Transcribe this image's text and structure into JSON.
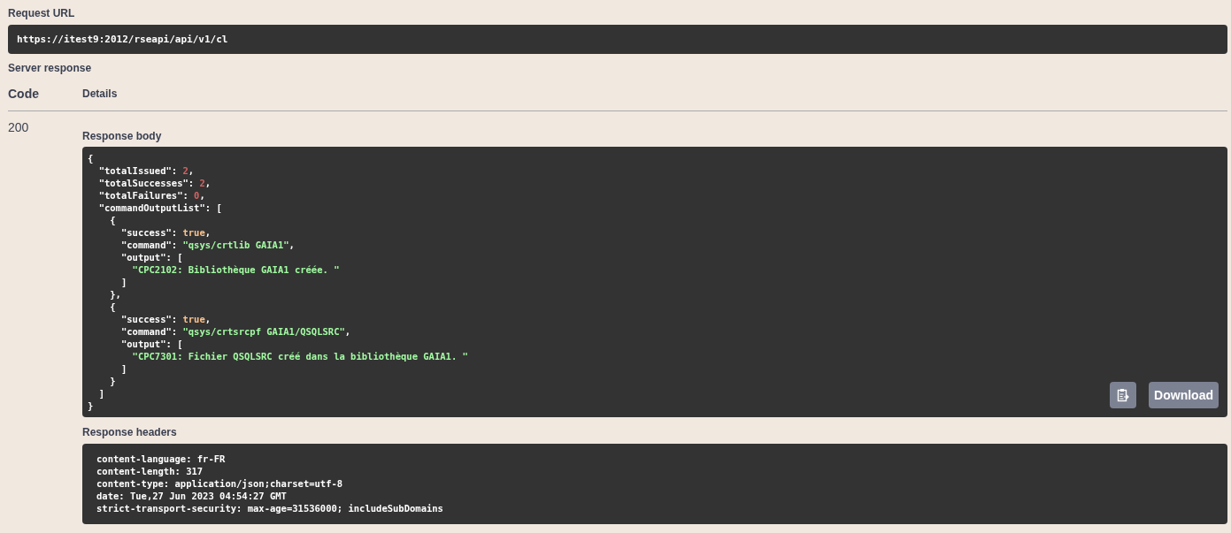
{
  "request_url": {
    "label": "Request URL",
    "value": "https://itest9:2012/rseapi/api/v1/cl"
  },
  "server_response": {
    "label": "Server response",
    "columns": [
      "Code",
      "Details"
    ],
    "code": "200",
    "body": {
      "label": "Response body",
      "lines": [
        [
          {
            "kind": "punct",
            "text": "{"
          }
        ],
        [
          {
            "kind": "punct",
            "text": "  \"totalIssued\": "
          },
          {
            "kind": "number",
            "text": "2"
          },
          {
            "kind": "punct",
            "text": ","
          }
        ],
        [
          {
            "kind": "punct",
            "text": "  \"totalSuccesses\": "
          },
          {
            "kind": "number",
            "text": "2"
          },
          {
            "kind": "punct",
            "text": ","
          }
        ],
        [
          {
            "kind": "punct",
            "text": "  \"totalFailures\": "
          },
          {
            "kind": "number",
            "text": "0"
          },
          {
            "kind": "punct",
            "text": ","
          }
        ],
        [
          {
            "kind": "punct",
            "text": "  \"commandOutputList\": ["
          }
        ],
        [
          {
            "kind": "punct",
            "text": "    {"
          }
        ],
        [
          {
            "kind": "punct",
            "text": "      \"success\": "
          },
          {
            "kind": "boolean",
            "text": "true"
          },
          {
            "kind": "punct",
            "text": ","
          }
        ],
        [
          {
            "kind": "punct",
            "text": "      \"command\": "
          },
          {
            "kind": "string",
            "text": "\"qsys/crtlib GAIA1\""
          },
          {
            "kind": "punct",
            "text": ","
          }
        ],
        [
          {
            "kind": "punct",
            "text": "      \"output\": ["
          }
        ],
        [
          {
            "kind": "string",
            "text": "        \"CPC2102: Bibliothèque GAIA1 créée. \""
          }
        ],
        [
          {
            "kind": "punct",
            "text": "      ]"
          }
        ],
        [
          {
            "kind": "punct",
            "text": "    },"
          }
        ],
        [
          {
            "kind": "punct",
            "text": "    {"
          }
        ],
        [
          {
            "kind": "punct",
            "text": "      \"success\": "
          },
          {
            "kind": "boolean",
            "text": "true"
          },
          {
            "kind": "punct",
            "text": ","
          }
        ],
        [
          {
            "kind": "punct",
            "text": "      \"command\": "
          },
          {
            "kind": "string",
            "text": "\"qsys/crtsrcpf GAIA1/QSQLSRC\""
          },
          {
            "kind": "punct",
            "text": ","
          }
        ],
        [
          {
            "kind": "punct",
            "text": "      \"output\": ["
          }
        ],
        [
          {
            "kind": "string",
            "text": "        \"CPC7301: Fichier QSQLSRC créé dans la bibliothèque GAIA1. \""
          }
        ],
        [
          {
            "kind": "punct",
            "text": "      ]"
          }
        ],
        [
          {
            "kind": "punct",
            "text": "    }"
          }
        ],
        [
          {
            "kind": "punct",
            "text": "  ]"
          }
        ],
        [
          {
            "kind": "punct",
            "text": "}"
          }
        ]
      ],
      "download_button": "Download"
    },
    "headers": {
      "label": "Response headers",
      "lines": [
        "content-language: fr-FR",
        "content-length: 317",
        "content-type: application/json;charset=utf-8",
        "date: Tue,27 Jun 2023 04:54:27 GMT",
        "strict-transport-security: max-age=31536000; includeSubDomains"
      ]
    }
  }
}
